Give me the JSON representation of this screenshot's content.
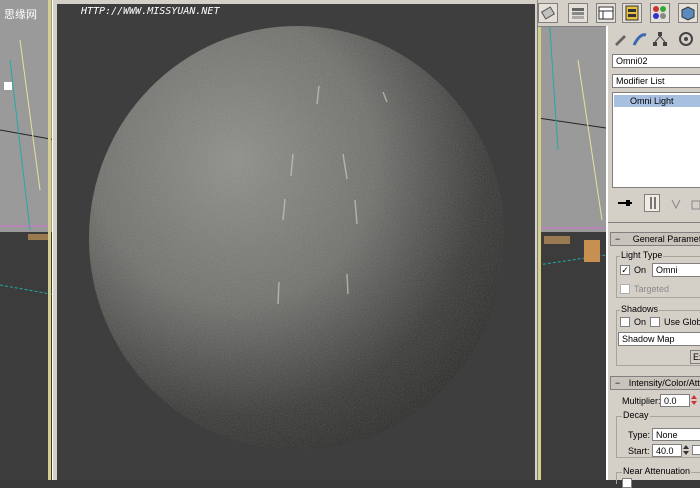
{
  "watermark": {
    "site": "HTTP://WWW.MISSYUAN.NET",
    "cn": "思缘网"
  },
  "command_panel": {
    "object_name": "Omni02",
    "modifier_list": "Modifier List",
    "stack_item": "Omni Light",
    "general_params": {
      "title": "General Paramete",
      "light_type_label": "Light Type",
      "on_label": "On",
      "on_checked": true,
      "type_value": "Omni",
      "targeted_label": "Targeted",
      "shadows_label": "Shadows",
      "shadows_on_label": "On",
      "use_global_label": "Use Global",
      "shadow_type": "Shadow Map",
      "exclude_label": "Ex"
    },
    "intensity": {
      "title": "Intensity/Color/Atten",
      "multiplier_label": "Multiplier:",
      "multiplier_value": "0.0",
      "decay_label": "Decay",
      "type_label": "Type:",
      "type_value": "None",
      "start_label": "Start:",
      "start_value": "40.0",
      "near_atten_label": "Near Attenuation"
    }
  },
  "colors": {
    "panel_bg": "#d4d0c8",
    "stack_highlight": "#a8c0e0",
    "render_bg": "#3e3e3e",
    "viewport_frame": "#d6cf8a"
  }
}
